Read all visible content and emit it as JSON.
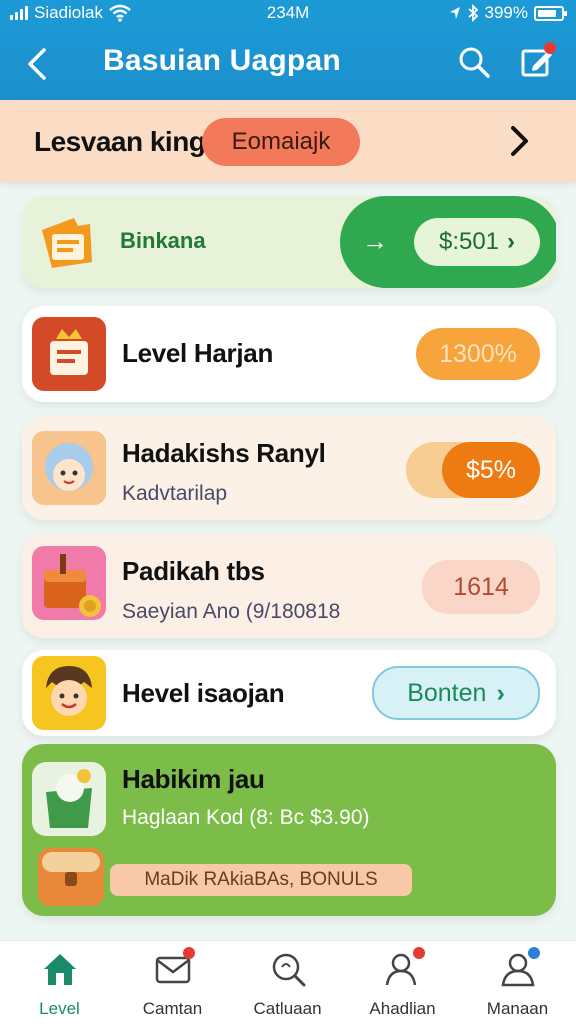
{
  "status_bar": {
    "carrier": "Siadiolak",
    "time": "234M",
    "battery": "399%"
  },
  "header": {
    "title": "Basuian Uagpan"
  },
  "banner": {
    "title": "Lesvaan king",
    "pill": "Eomaiajk"
  },
  "bonus_card": {
    "label": "Binkana",
    "amount": "$:501"
  },
  "rows": [
    {
      "title": "Level Harjan",
      "subtitle": "",
      "pill": "1300%"
    },
    {
      "title": "Hadakishs Ranyl",
      "subtitle": "Kadvtarilap",
      "pill": "$5%"
    },
    {
      "title": "Padikah tbs",
      "subtitle": "Saeyian Ano (9/180818",
      "pill": "1614"
    },
    {
      "title": "Hevel isaojan",
      "subtitle": "",
      "pill": "Bonten"
    }
  ],
  "promo": {
    "title": "Habikim jau",
    "subtitle": "Haglaan Kod (8: Bc $3.90)",
    "tag": "MaDik RAkiaBAs, BONULS"
  },
  "tabs": [
    {
      "label": "Level",
      "icon": "home-icon"
    },
    {
      "label": "Camtan",
      "icon": "mail-icon"
    },
    {
      "label": "Catluaan",
      "icon": "search-icon"
    },
    {
      "label": "Ahadlian",
      "icon": "user-badge-icon"
    },
    {
      "label": "Manaan",
      "icon": "profile-icon"
    }
  ],
  "colors": {
    "header_blue": "#1d9bd6",
    "banner_peach": "#fbdcc4",
    "accent_green": "#2fa84f",
    "promo_green": "#7cbc48",
    "orange": "#ee7a12"
  }
}
